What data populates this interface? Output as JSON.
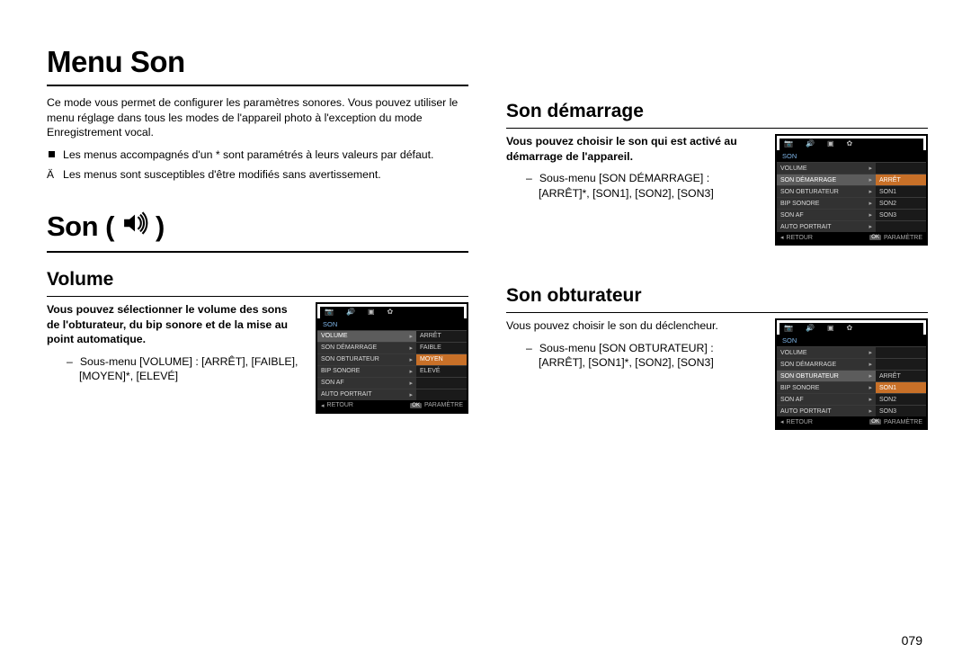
{
  "page_title": "Menu Son",
  "intro": "Ce mode vous permet de configurer les paramètres sonores. Vous pouvez utiliser le menu réglage dans tous les modes de l'appareil photo à l'exception du mode Enregistrement vocal.",
  "bullet1": "Les menus accompagnés d'un * sont paramétrés à leurs valeurs par défaut.",
  "note1": "Les menus sont susceptibles d'être modifiés sans avertissement.",
  "son_heading": "Son (",
  "son_heading_close": " )",
  "volume": {
    "title": "Volume",
    "lead": "Vous pouvez sélectionner le volume des sons de l'obturateur, du bip sonore et de la mise au point automatique.",
    "sub1": "Sous-menu [VOLUME] : [ARRÊT], [FAIBLE], [MOYEN]*, [ELEVÉ]"
  },
  "demarrage": {
    "title": "Son démarrage",
    "lead": "Vous pouvez choisir le son qui est activé au démarrage de l'appareil.",
    "sub1": "Sous-menu [SON DÉMARRAGE] : [ARRÊT]*, [SON1], [SON2], [SON3]"
  },
  "obturateur": {
    "title": "Son obturateur",
    "lead": "Vous pouvez choisir le son du déclencheur.",
    "sub1": "Sous-menu [SON OBTURATEUR] : [ARRÊT], [SON1]*, [SON2], [SON3]"
  },
  "lcd_common": {
    "icons": {
      "camera": "📷",
      "sound": "🔊",
      "screen": "▣",
      "gear": "✿"
    },
    "header": "SON",
    "rows": [
      "VOLUME",
      "SON DÉMARRAGE",
      "SON OBTURATEUR",
      "BIP SONORE",
      "SON AF",
      "AUTO PORTRAIT"
    ],
    "footer_back": "RETOUR",
    "footer_ok": "OK",
    "footer_set": "PARAMÈTRE"
  },
  "lcd_volume_vals": [
    "ARRÊT",
    "FAIBLE",
    "MOYEN",
    "ELEVÉ",
    "",
    ""
  ],
  "lcd_volume_sel_row": 0,
  "lcd_volume_sel_val": 2,
  "lcd_dem_vals": [
    "",
    "ARRÊT",
    "SON1",
    "SON2",
    "SON3",
    ""
  ],
  "lcd_dem_sel_row": 1,
  "lcd_dem_sel_val": 1,
  "lcd_obt_vals": [
    "",
    "",
    "ARRÊT",
    "SON1",
    "SON2",
    "SON3"
  ],
  "lcd_obt_sel_row": 2,
  "lcd_obt_sel_val": 3,
  "page_number": "079"
}
